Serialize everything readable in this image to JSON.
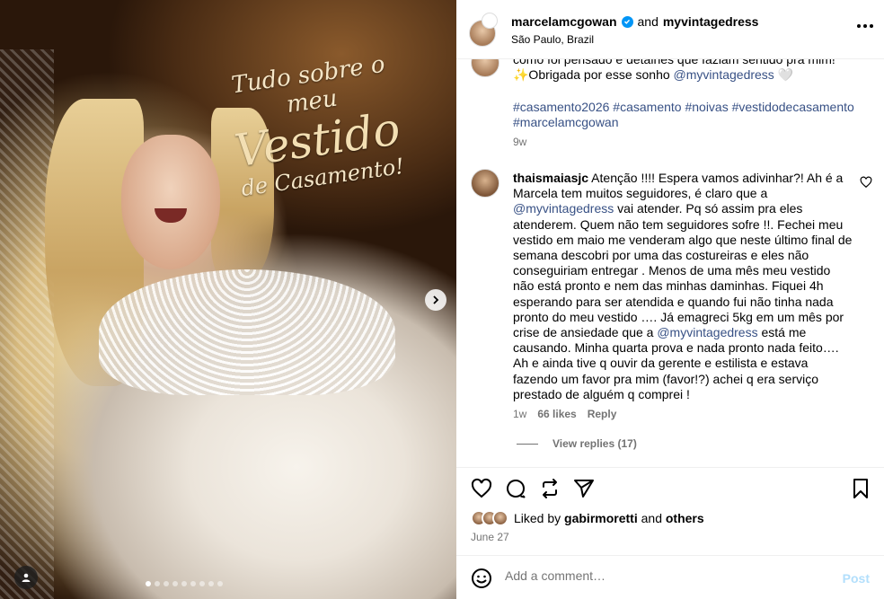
{
  "photo": {
    "overlay_line1": "Tudo sobre o meu",
    "overlay_line2": "Vestido",
    "overlay_line3": "de Casamento!",
    "carousel_count": 9,
    "carousel_active": 0
  },
  "header": {
    "username": "marcelamcgowan",
    "and_text": "and",
    "collaborator": "myvintagedress",
    "location": "São Paulo, Brazil"
  },
  "caption": {
    "line1": "como foi pensado e detalhes que faziam sentido pra mim!",
    "line2_prefix": "✨Obrigada por esse sonho ",
    "line2_mention": "@myvintagedress",
    "line2_suffix": " 🤍",
    "hashtags": "#casamento2026 #casamento #noivas #vestidodecasamento #marcelamcgowan",
    "time": "9w"
  },
  "comment": {
    "username": "thaismaiasjc",
    "text_part1": " Atenção !!!! Espera vamos adivinhar?! Ah é a Marcela tem muitos seguidores, é claro que a ",
    "mention1": "@myvintagedress",
    "text_part2": " vai atender. Pq só assim pra eles atenderem. Quem não tem seguidores sofre !!. Fechei meu vestido em maio me venderam algo que neste último final de semana descobri por uma das costureiras e eles não conseguiriam entregar . Menos de uma mês meu vestido não está pronto e nem das minhas daminhas. Fiquei 4h esperando para ser atendida e quando fui não tinha nada pronto do meu vestido …. Já emagreci 5kg em um mês por crise de ansiedade que a ",
    "mention2": "@myvintagedress",
    "text_part3": " está me causando. Minha quarta prova e nada pronto nada feito…. Ah e ainda tive q ouvir da gerente e estilista e estava fazendo um favor pra mim (favor!?) achei q era serviço prestado de alguém q comprei !",
    "time": "1w",
    "likes": "66 likes",
    "reply": "Reply",
    "view_replies": "View replies (17)"
  },
  "likes": {
    "prefix": "Liked by",
    "user": "gabirmoretti",
    "and": "and",
    "others": "others"
  },
  "date": "June 27",
  "add_comment": {
    "placeholder": "Add a comment…",
    "post": "Post"
  },
  "icons": [
    "verified-badge-icon",
    "more-options-icon",
    "heart-icon",
    "comment-icon",
    "repost-icon",
    "share-icon",
    "bookmark-icon",
    "emoji-icon",
    "chevron-right-icon",
    "user-tag-icon"
  ],
  "colors": {
    "link": "#385185",
    "verified": "#0095f6",
    "post_disabled": "#b2dffc",
    "muted": "#737373"
  }
}
